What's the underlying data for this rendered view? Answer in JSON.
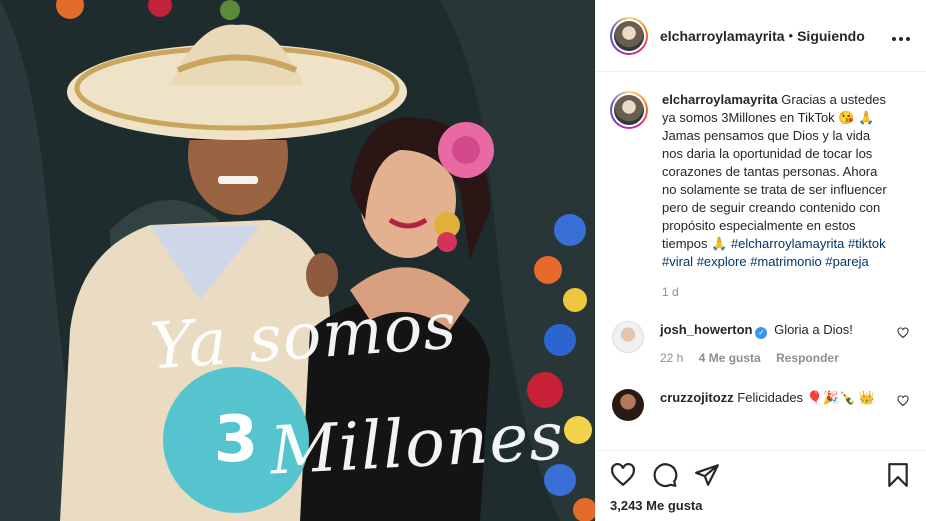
{
  "post": {
    "username": "elcharroylamayrita",
    "follow_status": "Siguiendo",
    "separator": "•",
    "caption_author": "elcharroylamayrita",
    "caption_text": "Gracias a ustedes ya somos 3Millones en TikTok 😘 🙏 Jamas pensamos que Dios y la vida nos daria la oportunidad de tocar los corazones de tantas personas. Ahora no solamente se trata de ser influencer pero de seguir creando contenido con propósito especialmente en estos tiempos 🙏",
    "hashtags": [
      "#elcharroylamayrita",
      "#tiktok",
      "#viral",
      "#explore",
      "#matrimonio",
      "#pareja"
    ],
    "time_ago": "1 d",
    "likes": "3,243 Me gusta"
  },
  "image_overlay": {
    "line1": "Ya somos",
    "number": "3",
    "line2": "Millones"
  },
  "comments": [
    {
      "username": "josh_howerton",
      "verified": true,
      "text": "Gloria a Dios!",
      "time": "22 h",
      "likes": "4 Me gusta",
      "reply": "Responder"
    },
    {
      "username": "cruzzojitozz",
      "verified": false,
      "text": "Felicidades 🎈🎉🍾 👑"
    }
  ],
  "icons": [
    "more-icon",
    "heart-icon",
    "comment-icon",
    "share-icon",
    "save-icon"
  ]
}
